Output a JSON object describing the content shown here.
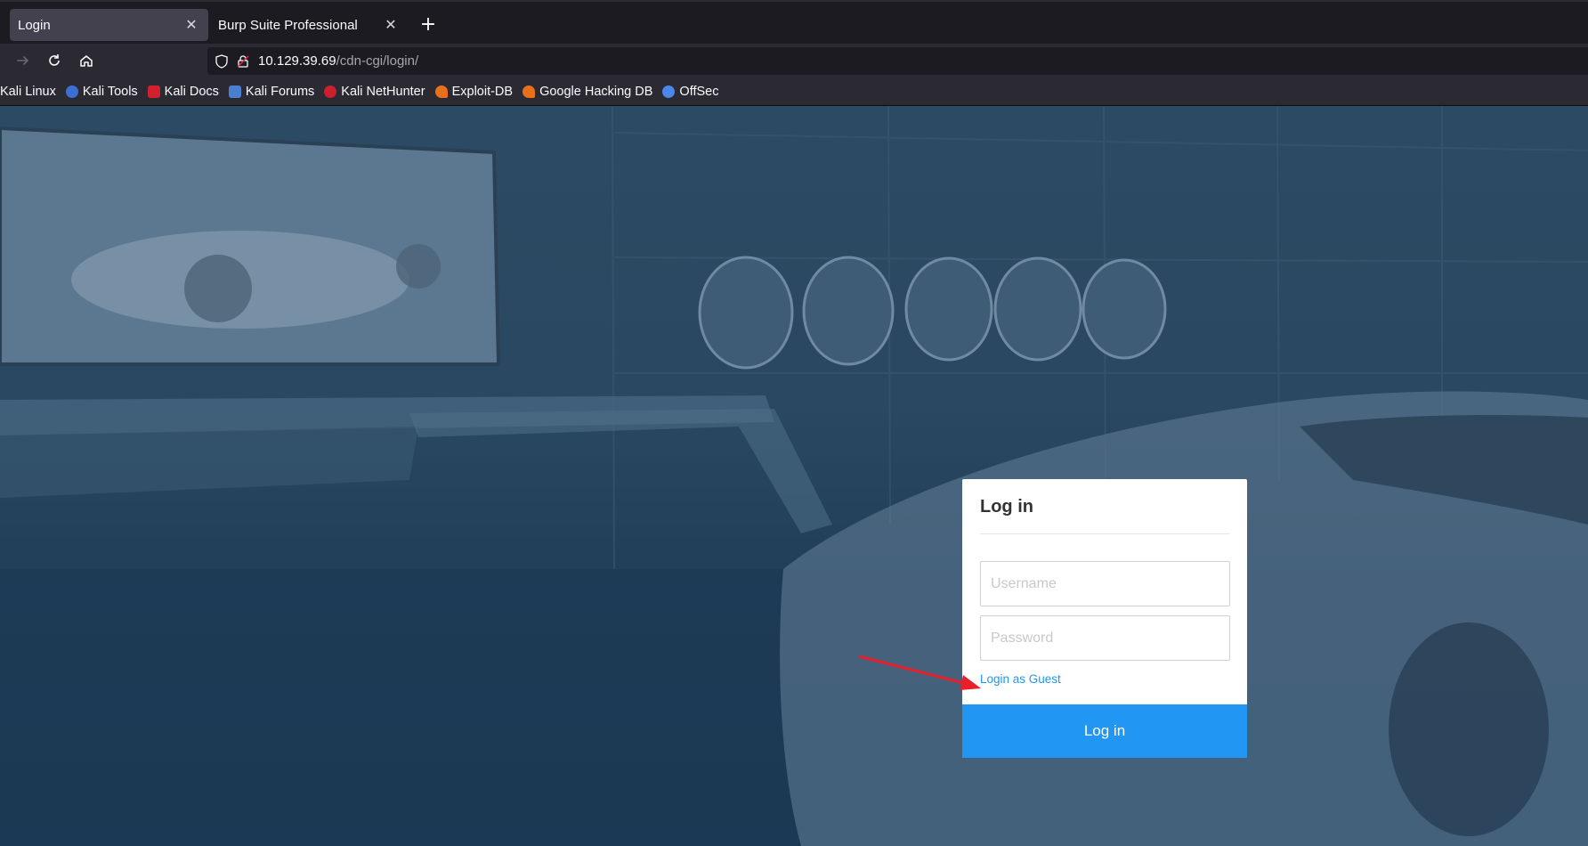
{
  "tabs": [
    {
      "title": "Login",
      "active": true
    },
    {
      "title": "Burp Suite Professional",
      "active": false
    }
  ],
  "newtab": {
    "glyph": "+"
  },
  "toolbar": {
    "url_host": "10.129.39.69",
    "url_path": "/cdn-cgi/login/"
  },
  "bookmarks": [
    {
      "label": "Kali Linux",
      "icon": "kali-icon",
      "color": ""
    },
    {
      "label": "Kali Tools",
      "icon": "kali-tools-icon",
      "color": "#3b6fd1"
    },
    {
      "label": "Kali Docs",
      "icon": "kali-docs-icon",
      "color": "#d3202f"
    },
    {
      "label": "Kali Forums",
      "icon": "kali-forums-icon",
      "color": "#4a7fd0"
    },
    {
      "label": "Kali NetHunter",
      "icon": "nethunter-icon",
      "color": "#c8202c"
    },
    {
      "label": "Exploit-DB",
      "icon": "exploit-db-icon",
      "color": "#e8701a"
    },
    {
      "label": "Google Hacking DB",
      "icon": "ghdb-icon",
      "color": "#e8701a"
    },
    {
      "label": "OffSec",
      "icon": "offsec-icon",
      "color": "#4a87e8"
    }
  ],
  "login": {
    "title": "Log in",
    "username_placeholder": "Username",
    "password_placeholder": "Password",
    "guest_link": "Login as Guest",
    "submit_label": "Log in"
  },
  "colors": {
    "accent": "#2196f3",
    "annotation_arrow": "#e8202a"
  }
}
